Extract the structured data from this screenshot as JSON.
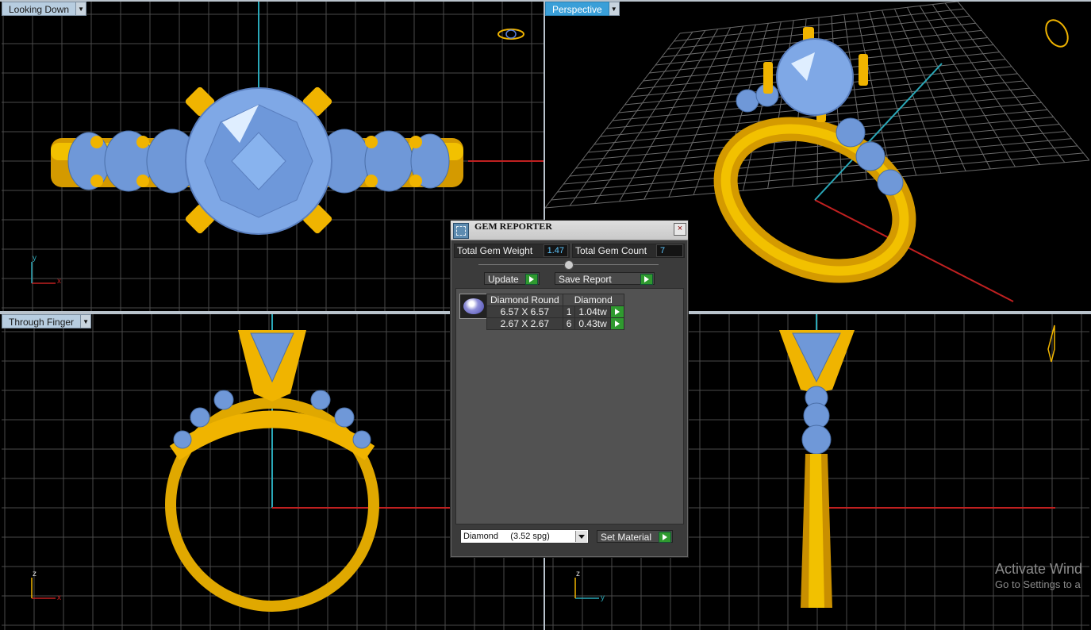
{
  "viewports": {
    "top_left": {
      "label": "Looking Down",
      "axes": {
        "h": "x",
        "v": "y"
      }
    },
    "top_right": {
      "label": "Perspective"
    },
    "bottom_left": {
      "label": "Through Finger",
      "axes": {
        "h": "x",
        "v": "z"
      }
    },
    "bottom_right": {
      "axes": {
        "h": "y",
        "v": "z"
      }
    }
  },
  "gem_reporter": {
    "title": "GEM REPORTER",
    "close": "×",
    "total_weight_label": "Total Gem Weight",
    "total_weight_value": "1.47",
    "total_count_label": "Total Gem Count",
    "total_count_value": "7",
    "update_label": "Update",
    "save_report_label": "Save Report",
    "table": {
      "headers": [
        "Diamond Round",
        "Diamond"
      ],
      "rows": [
        {
          "size": "6.57 X 6.57",
          "count": "1",
          "weight": "1.04tw"
        },
        {
          "size": "2.67 X 2.67",
          "count": "6",
          "weight": "0.43tw"
        }
      ]
    },
    "material_select": "Diamond     (3.52 spg)",
    "set_material_label": "Set Material"
  },
  "watermark": {
    "line1": "Activate Wind",
    "line2": "Go to Settings to a"
  },
  "colors": {
    "gold": "#f0b400",
    "gem": "#7fa8e6",
    "grid": "#4a4a4a",
    "axis_red": "#c02020",
    "axis_cyan": "#2aa8b8",
    "active_tab": "#3a9fd8"
  }
}
